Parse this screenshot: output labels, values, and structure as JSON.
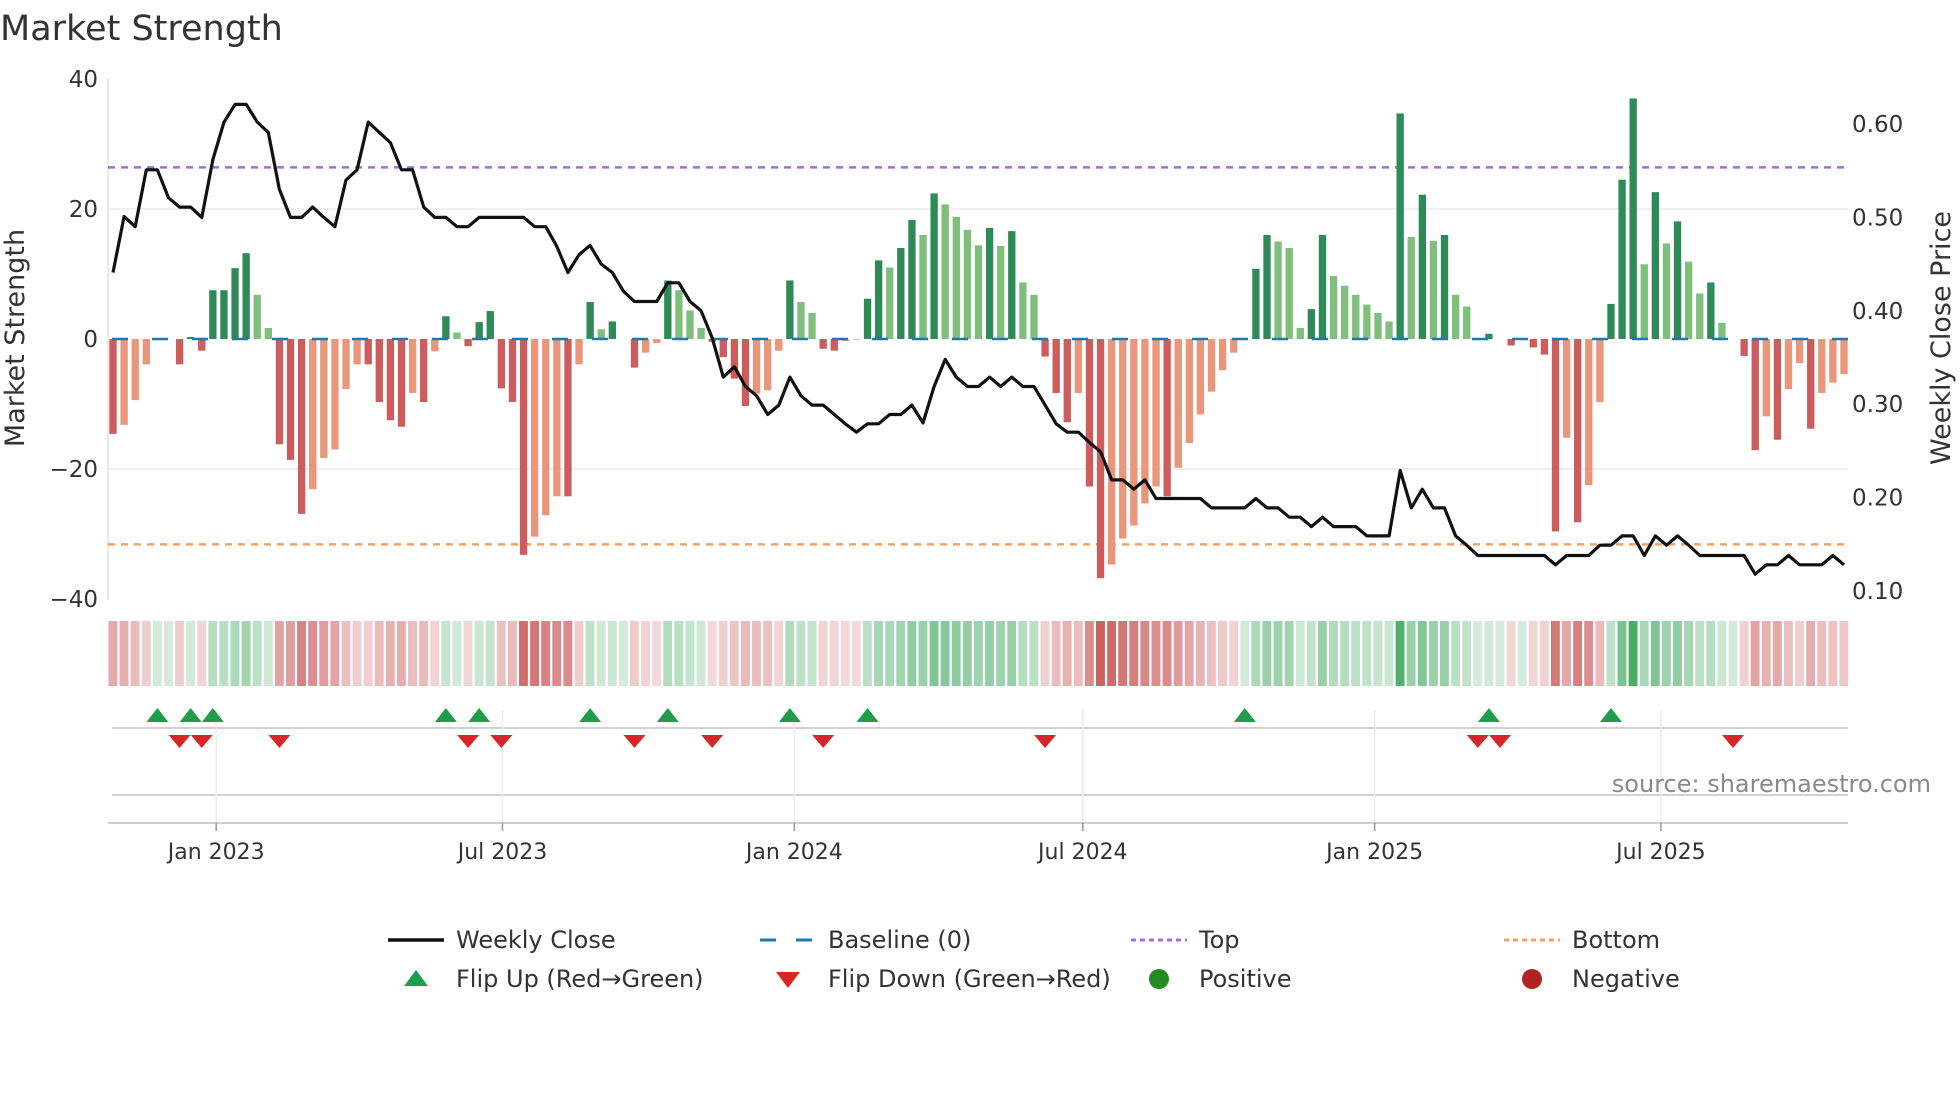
{
  "chart_data": {
    "type": "bar",
    "title": "Market Strength",
    "ylabel_left": "Market Strength",
    "ylabel_right": "Weekly Close Price",
    "ylim_left": [
      -40,
      40
    ],
    "ylim_right": [
      0.1,
      0.6
    ],
    "yticks_left": [
      {
        "v": 40,
        "label": "40"
      },
      {
        "v": 20,
        "label": "20"
      },
      {
        "v": 0,
        "label": "0"
      },
      {
        "v": -20,
        "label": "−20"
      },
      {
        "v": -40,
        "label": "−40"
      }
    ],
    "yticks_right": [
      {
        "v": 0.6,
        "label": "0.60"
      },
      {
        "v": 0.5,
        "label": "0.50"
      },
      {
        "v": 0.4,
        "label": "0.40"
      },
      {
        "v": 0.3,
        "label": "0.30"
      },
      {
        "v": 0.2,
        "label": "0.20"
      },
      {
        "v": 0.1,
        "label": "0.10"
      }
    ],
    "xticks_week_index": [
      {
        "w": 9.3,
        "label": "Jan 2023"
      },
      {
        "w": 35.1,
        "label": "Jul 2023"
      },
      {
        "w": 61.4,
        "label": "Jan 2024"
      },
      {
        "w": 87.4,
        "label": "Jul 2024"
      },
      {
        "w": 113.7,
        "label": "Jan 2025"
      },
      {
        "w": 139.5,
        "label": "Jul 2025"
      }
    ],
    "top_level": 26.4,
    "bottom_level": -31.6,
    "baseline": 0,
    "strength": [
      -14.6,
      -13.2,
      -9.4,
      -3.9,
      0,
      0,
      -3.9,
      0.3,
      -1.8,
      7.5,
      7.5,
      10.9,
      13.2,
      6.8,
      1.7,
      -16.2,
      -18.6,
      -26.9,
      -23.1,
      -18.3,
      -17.0,
      -7.7,
      -3.9,
      -3.9,
      -9.7,
      -12.5,
      -13.5,
      -8.3,
      -9.7,
      -1.9,
      3.5,
      1.0,
      -1.1,
      2.6,
      4.3,
      -7.6,
      -9.7,
      -33.2,
      -30.4,
      -27.1,
      -24.2,
      -24.2,
      -3.9,
      5.7,
      1.5,
      2.7,
      0,
      -4.4,
      -2.1,
      -0.6,
      9.0,
      7.5,
      4.4,
      1.7,
      -0.4,
      -2.8,
      -6.1,
      -10.3,
      -8.4,
      -7.9,
      -1.8,
      9.0,
      5.7,
      4.0,
      -1.5,
      -1.8,
      -0.3,
      -0.1,
      6.2,
      12.1,
      11.0,
      14.0,
      18.3,
      16.0,
      22.4,
      20.7,
      18.8,
      16.8,
      14.4,
      17.1,
      14.3,
      16.6,
      8.7,
      6.8,
      -2.7,
      -8.3,
      -12.8,
      -8.3,
      -22.7,
      -36.8,
      -34.7,
      -30.7,
      -28.7,
      -25.3,
      -22.7,
      -24.2,
      -19.8,
      -16.0,
      -11.6,
      -8.1,
      -4.8,
      -2.1,
      0,
      10.8,
      16.0,
      15.0,
      14.0,
      1.7,
      4.6,
      16.0,
      9.7,
      8.2,
      6.8,
      5.3,
      4.0,
      2.7,
      34.7,
      15.7,
      22.2,
      15.1,
      16.0,
      6.8,
      5.0,
      0,
      0.8,
      0,
      -1.0,
      0,
      -1.3,
      -2.4,
      -29.6,
      -15.2,
      -28.2,
      -22.5,
      -9.7,
      5.4,
      24.5,
      37.0,
      11.5,
      22.6,
      14.7,
      18.1,
      11.9,
      7.0,
      8.7,
      2.5,
      0,
      -2.6,
      -17.1,
      -11.9,
      -15.5,
      -7.7,
      -3.7,
      -13.8,
      -8.3,
      -6.7,
      -5.4
    ],
    "weekly_close": [
      0.441,
      0.501,
      0.49,
      0.551,
      0.551,
      0.521,
      0.511,
      0.511,
      0.5,
      0.562,
      0.602,
      0.621,
      0.621,
      0.602,
      0.591,
      0.53,
      0.5,
      0.5,
      0.511,
      0.5,
      0.49,
      0.54,
      0.551,
      0.602,
      0.591,
      0.58,
      0.551,
      0.551,
      0.511,
      0.5,
      0.5,
      0.49,
      0.49,
      0.5,
      0.5,
      0.5,
      0.5,
      0.5,
      0.49,
      0.49,
      0.469,
      0.441,
      0.46,
      0.47,
      0.45,
      0.441,
      0.421,
      0.41,
      0.41,
      0.41,
      0.43,
      0.43,
      0.41,
      0.4,
      0.371,
      0.329,
      0.34,
      0.319,
      0.309,
      0.289,
      0.299,
      0.329,
      0.309,
      0.299,
      0.299,
      0.289,
      0.279,
      0.27,
      0.279,
      0.279,
      0.289,
      0.289,
      0.299,
      0.28,
      0.319,
      0.348,
      0.329,
      0.319,
      0.319,
      0.329,
      0.319,
      0.329,
      0.319,
      0.319,
      0.299,
      0.279,
      0.27,
      0.27,
      0.259,
      0.249,
      0.219,
      0.219,
      0.209,
      0.219,
      0.199,
      0.199,
      0.199,
      0.199,
      0.199,
      0.189,
      0.189,
      0.189,
      0.189,
      0.199,
      0.189,
      0.189,
      0.179,
      0.179,
      0.169,
      0.179,
      0.169,
      0.169,
      0.169,
      0.159,
      0.159,
      0.159,
      0.229,
      0.189,
      0.209,
      0.189,
      0.189,
      0.159,
      0.149,
      0.138,
      0.138,
      0.138,
      0.138,
      0.138,
      0.138,
      0.138,
      0.128,
      0.138,
      0.138,
      0.138,
      0.149,
      0.149,
      0.159,
      0.159,
      0.138,
      0.159,
      0.149,
      0.159,
      0.149,
      0.138,
      0.138,
      0.138,
      0.138,
      0.138,
      0.118,
      0.128,
      0.128,
      0.138,
      0.128,
      0.128,
      0.128,
      0.138,
      0.128
    ],
    "flip_up_weeks": [
      4,
      7,
      9,
      30,
      33,
      43,
      50,
      61,
      68,
      102,
      124,
      135
    ],
    "flip_down_weeks": [
      6,
      8,
      15,
      32,
      35,
      47,
      54,
      64,
      84,
      123,
      125,
      146
    ],
    "legend": [
      {
        "label": "Weekly Close",
        "kind": "line",
        "color": "#111111"
      },
      {
        "label": "Baseline (0)",
        "kind": "dash",
        "color": "#1f77b4"
      },
      {
        "label": "Top",
        "kind": "dot",
        "color": "#9b6ee0"
      },
      {
        "label": "Bottom",
        "kind": "dot",
        "color": "#f4a261"
      },
      {
        "label": "Flip Up (Red→Green)",
        "kind": "up",
        "color": "#1e9e4a"
      },
      {
        "label": "Flip Down (Green→Red)",
        "kind": "down",
        "color": "#d62728"
      },
      {
        "label": "Positive",
        "kind": "circle",
        "color": "#228b22"
      },
      {
        "label": "Negative",
        "kind": "circle",
        "color": "#b22222"
      }
    ],
    "colors": {
      "pos_strong": "#2e8b57",
      "pos_weak": "#7fbf7b",
      "neg_strong": "#cd5c5c",
      "neg_weak": "#e9967a",
      "grid": "#ebebeb"
    }
  },
  "source": "source: sharemaestro.com"
}
